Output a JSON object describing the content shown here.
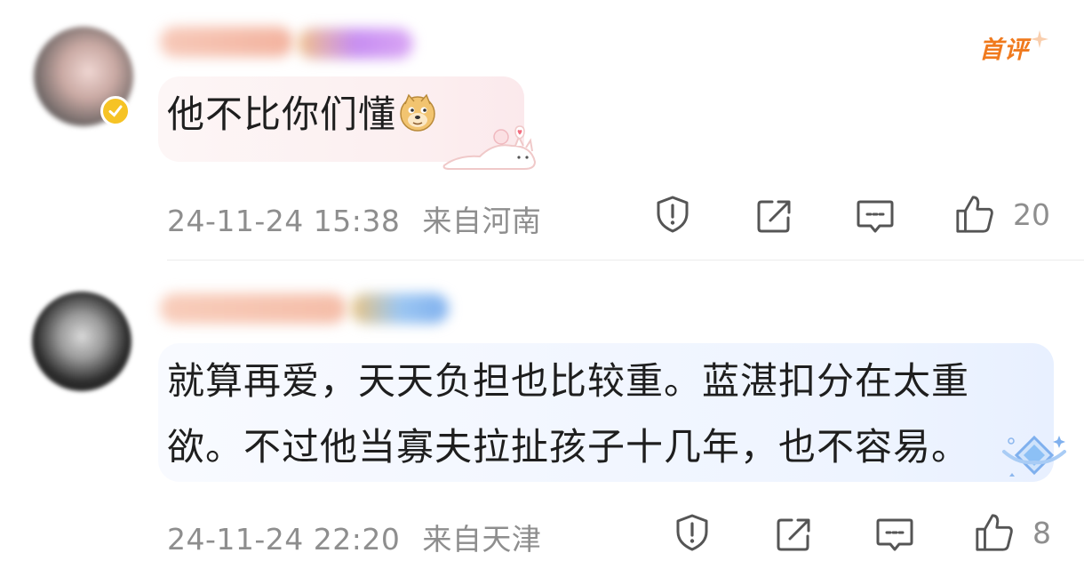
{
  "comments": [
    {
      "text": "他不比你们懂",
      "emoji": "doge-emoji",
      "badge": "首评",
      "timestamp": "24-11-24 15:38",
      "location": "来自河南",
      "likes": "20"
    },
    {
      "text": "就算再爱，天天负担也比较重。蓝湛扣分在太重欲。不过他当寡夫拉扯孩子十几年，也不容易。",
      "timestamp": "24-11-24 22:20",
      "location": "来自天津",
      "likes": "8"
    }
  ],
  "icons": {
    "report": "shield-exclamation-icon",
    "share": "share-icon",
    "reply": "comment-icon",
    "like": "thumbs-up-icon"
  },
  "colors": {
    "badge": "#f07a1e",
    "meta": "#8e8e8e",
    "verified": "#f6c325"
  }
}
